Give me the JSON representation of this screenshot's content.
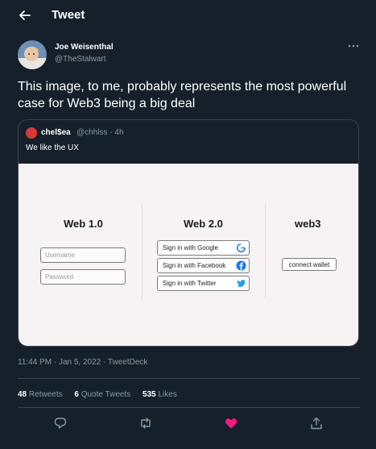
{
  "header": {
    "title": "Tweet"
  },
  "tweet": {
    "author_name": "Joe Weisenthal",
    "author_handle": "@TheStalwart",
    "text": "This image, to me, probably represents the most powerful case for Web3 being a big deal",
    "timestamp": "11:44 PM · Jan 5, 2022 · TweetDeck",
    "stats": {
      "retweets_count": "48",
      "retweets_label": "Retweets",
      "quotes_count": "6",
      "quotes_label": "Quote Tweets",
      "likes_count": "535",
      "likes_label": "Likes"
    },
    "liked": true
  },
  "quote": {
    "author_name": "chel$ea",
    "author_handle": "@chhlss · 4h",
    "text": "We like the UX",
    "image": {
      "web1": {
        "title": "Web 1.0",
        "username_placeholder": "Username",
        "password_placeholder": "Password"
      },
      "web2": {
        "title": "Web 2.0",
        "google": "Sign in with Google",
        "facebook": "Sign in with Facebook",
        "twitter": "Sign in with Twitter"
      },
      "web3": {
        "title": "web3",
        "wallet": "connect wallet"
      }
    }
  },
  "colors": {
    "background": "#15202b",
    "secondary_text": "#8b98a5",
    "border": "#38444d",
    "like": "#f91880"
  },
  "icons": {
    "back": "arrow-left-icon",
    "more": "more-horizontal-icon",
    "reply": "reply-icon",
    "retweet": "retweet-icon",
    "like": "heart-filled-icon",
    "share": "share-icon"
  }
}
